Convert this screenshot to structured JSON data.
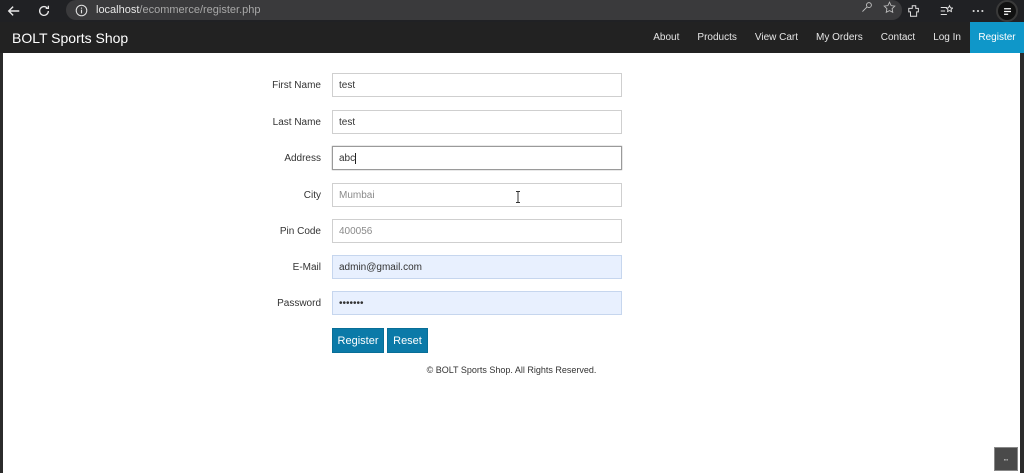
{
  "browser": {
    "url_host": "localhost",
    "url_path": "/ecommerce/register.php"
  },
  "navbar": {
    "brand": "BOLT Sports Shop",
    "items": [
      {
        "label": "About"
      },
      {
        "label": "Products"
      },
      {
        "label": "View Cart"
      },
      {
        "label": "My Orders"
      },
      {
        "label": "Contact"
      },
      {
        "label": "Log In"
      },
      {
        "label": "Register",
        "active": true
      }
    ],
    "active_color": "#0f97c9"
  },
  "form": {
    "first_name": {
      "label": "First Name",
      "value": "test"
    },
    "last_name": {
      "label": "Last Name",
      "value": "test"
    },
    "address": {
      "label": "Address",
      "value": "abc"
    },
    "city": {
      "label": "City",
      "placeholder": "Mumbai"
    },
    "pin_code": {
      "label": "Pin Code",
      "placeholder": "400056"
    },
    "email": {
      "label": "E-Mail",
      "value": "admin@gmail.com"
    },
    "password": {
      "label": "Password",
      "value": "•••••••"
    },
    "register_label": "Register",
    "reset_label": "Reset",
    "button_color": "#0b7aa8"
  },
  "footer": {
    "text": "© BOLT Sports Shop. All Rights Reserved."
  }
}
